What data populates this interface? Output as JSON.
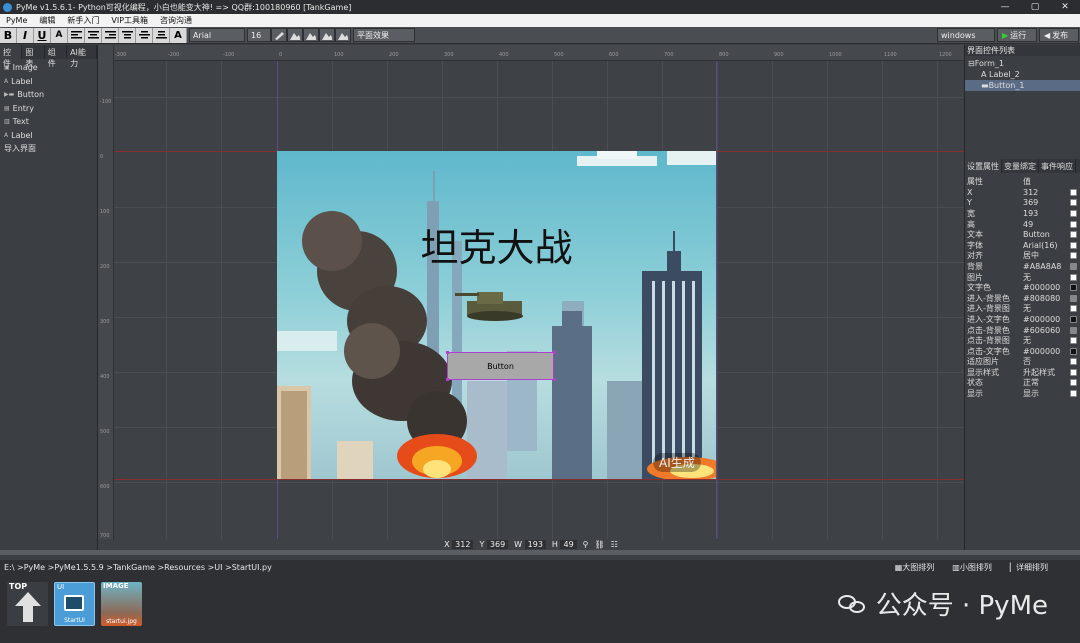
{
  "window": {
    "title": "PyMe v1.5.6.1- Python可视化编程，小白也能变大神!  => QQ群:100180960   [TankGame]",
    "controls": {
      "minimize": "—",
      "maximize": "▢",
      "close": "✕"
    }
  },
  "menu": [
    "PyMe",
    "编辑",
    "新手入门",
    "VIP工具箱",
    "咨询沟通"
  ],
  "toolbar": {
    "bold": "B",
    "italic": "I",
    "underline": "U",
    "font_color": "A",
    "font_family": "Arial",
    "font_size": "16",
    "effect": "平面效果",
    "platform": "windows",
    "run": "运行",
    "publish": "发布"
  },
  "left_panel": {
    "tabs": [
      "控件",
      "图表",
      "组件",
      "AI能力"
    ],
    "items": [
      {
        "label": "Image"
      },
      {
        "label": "Label"
      },
      {
        "label": "Button"
      },
      {
        "label": "Entry"
      },
      {
        "label": "Text"
      },
      {
        "label": "Label"
      },
      {
        "label": "导入界面"
      }
    ]
  },
  "canvas": {
    "ruler_h": [
      "-300",
      "-200",
      "-100",
      "0",
      "100",
      "200",
      "300",
      "400",
      "500",
      "600",
      "700",
      "800",
      "900",
      "1000",
      "1100",
      "1200"
    ],
    "ruler_v": [
      "-100",
      "0",
      "100",
      "200",
      "300",
      "400",
      "500",
      "600",
      "700"
    ],
    "form": {
      "title_text": "坦克大战",
      "button_label": "Button",
      "ai_badge": "AI生成"
    }
  },
  "status": {
    "x_label": "X",
    "x": "312",
    "y_label": "Y",
    "y": "369",
    "w_label": "W",
    "w": "193",
    "h_label": "H",
    "h": "49"
  },
  "right_panel": {
    "tree_title": "界面控件列表",
    "tree": [
      {
        "label": "Form_1",
        "level": 0
      },
      {
        "label": "Label_2",
        "level": 1
      },
      {
        "label": "Button_1",
        "level": 1,
        "selected": true
      }
    ],
    "tabs": [
      "设置属性",
      "变量绑定",
      "事件响应"
    ],
    "header": {
      "key": "属性",
      "value": "值"
    },
    "props": [
      {
        "k": "X",
        "v": "312"
      },
      {
        "k": "Y",
        "v": "369"
      },
      {
        "k": "宽",
        "v": "193"
      },
      {
        "k": "高",
        "v": "49"
      },
      {
        "k": "文本",
        "v": "Button"
      },
      {
        "k": "字体",
        "v": "Arial(16)"
      },
      {
        "k": "对齐",
        "v": "居中"
      },
      {
        "k": "背景",
        "v": "#A8A8A8"
      },
      {
        "k": "图片",
        "v": "无"
      },
      {
        "k": "文字色",
        "v": "#000000"
      },
      {
        "k": "进入-背景色",
        "v": "#808080"
      },
      {
        "k": "进入-背景图",
        "v": "无"
      },
      {
        "k": "进入-文字色",
        "v": "#000000"
      },
      {
        "k": "点击-背景色",
        "v": "#606060"
      },
      {
        "k": "点击-背景图",
        "v": "无"
      },
      {
        "k": "点击-文字色",
        "v": "#000000"
      },
      {
        "k": "适应图片",
        "v": "否"
      },
      {
        "k": "显示样式",
        "v": "升起样式"
      },
      {
        "k": "状态",
        "v": "正常"
      },
      {
        "k": "显示",
        "v": "显示"
      }
    ]
  },
  "path_bar": {
    "path": "E:\\ >PyMe >PyMe1.5.5.9 >TankGame >Resources >UI >StartUI.py",
    "view_options": [
      "大图排列",
      "小图排列",
      "详细排列"
    ]
  },
  "files": [
    {
      "tag": "TOP",
      "caption": ""
    },
    {
      "tag": "UI",
      "caption": "StartUI"
    },
    {
      "tag": "IMAGE",
      "caption": "startui.jpg"
    }
  ],
  "watermark": "公众号 · PyMe",
  "colors": {
    "accent_selection": "#5a6b86",
    "button_bg": "#A8A8A8",
    "selection_border": "#b040d0"
  }
}
